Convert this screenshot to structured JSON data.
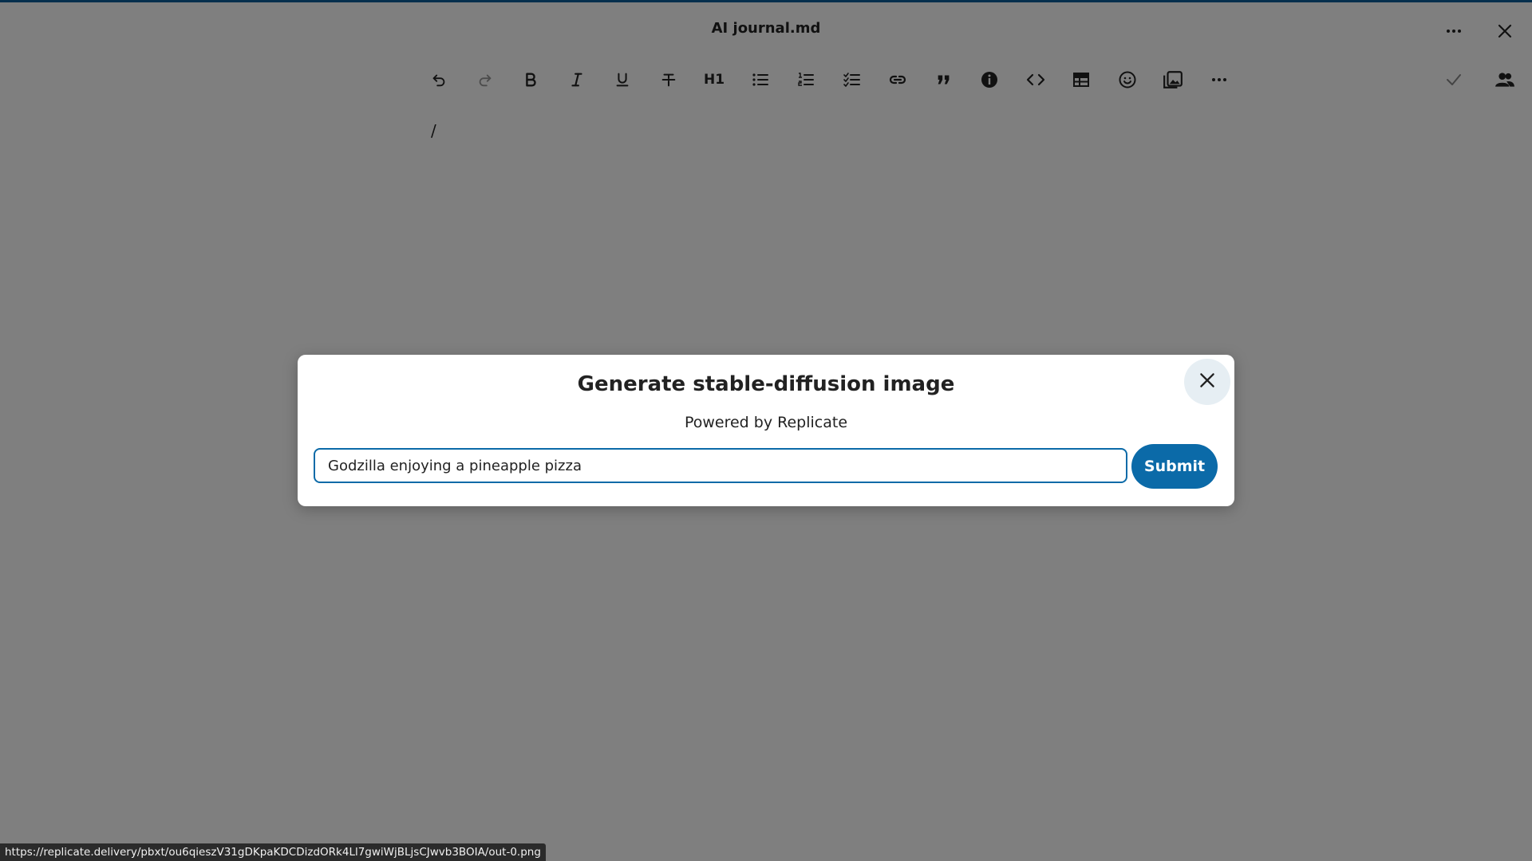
{
  "document": {
    "title": "AI journal.md",
    "content_text": "/"
  },
  "header": {
    "more_icon": "more-horizontal-icon",
    "close_icon": "close-icon"
  },
  "toolbar": {
    "buttons": [
      {
        "name": "undo",
        "icon": "undo-icon"
      },
      {
        "name": "redo",
        "icon": "redo-icon"
      },
      {
        "name": "bold",
        "icon": "bold-icon"
      },
      {
        "name": "italic",
        "icon": "italic-icon"
      },
      {
        "name": "underline",
        "icon": "underline-icon"
      },
      {
        "name": "strikethrough",
        "icon": "strikethrough-icon"
      },
      {
        "name": "heading",
        "label": "H1"
      },
      {
        "name": "bullet-list",
        "icon": "bullet-list-icon"
      },
      {
        "name": "numbered-list",
        "icon": "numbered-list-icon"
      },
      {
        "name": "checklist",
        "icon": "checklist-icon"
      },
      {
        "name": "link",
        "icon": "link-icon"
      },
      {
        "name": "blockquote",
        "icon": "quote-icon"
      },
      {
        "name": "callout",
        "icon": "info-icon"
      },
      {
        "name": "code",
        "icon": "code-icon"
      },
      {
        "name": "table",
        "icon": "table-icon"
      },
      {
        "name": "emoji",
        "icon": "emoji-icon"
      },
      {
        "name": "image",
        "icon": "image-icon"
      },
      {
        "name": "more",
        "icon": "more-horizontal-icon"
      }
    ],
    "saved_icon": "check-icon",
    "collaborators_icon": "users-icon"
  },
  "modal": {
    "title": "Generate stable-diffusion image",
    "subtitle": "Powered by Replicate",
    "input_value": "Godzilla enjoying a pineapple pizza",
    "submit_label": "Submit",
    "close_icon": "close-icon"
  },
  "status_bar": {
    "url": "https://replicate.delivery/pbxt/ou6qieszV31gDKpaKDCDizdORk4Ll7gwiWjBLjsCJwvb3BOIA/out-0.png"
  },
  "colors": {
    "accent": "#0b6aa8",
    "overlay": "rgba(0,0,0,0.5)",
    "close_button_bg": "#e6eef3"
  }
}
